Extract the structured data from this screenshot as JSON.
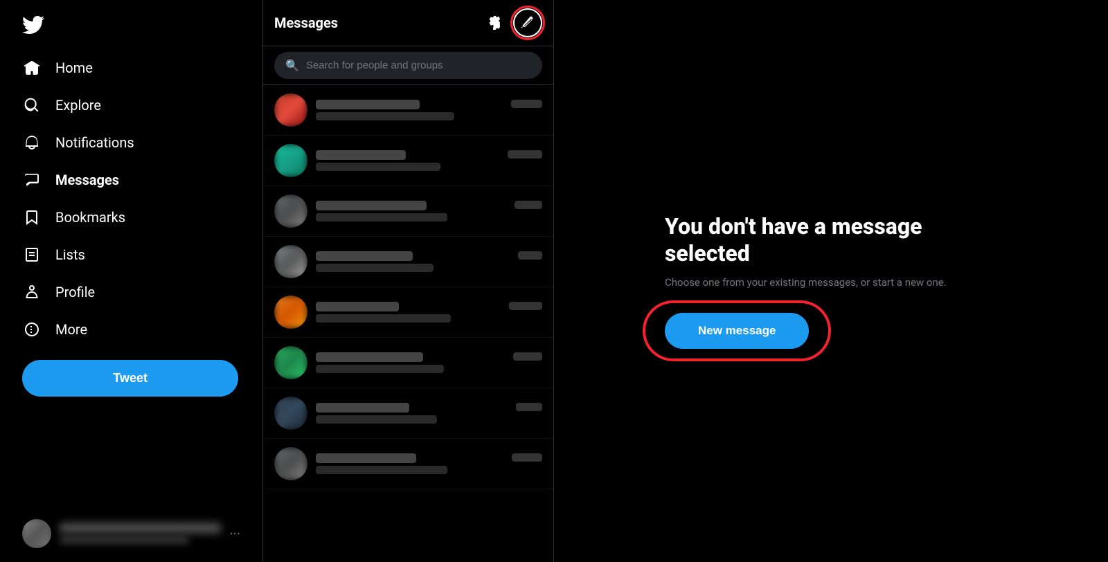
{
  "sidebar": {
    "logo_label": "Twitter",
    "nav_items": [
      {
        "id": "home",
        "label": "Home",
        "icon": "home"
      },
      {
        "id": "explore",
        "label": "Explore",
        "icon": "explore"
      },
      {
        "id": "notifications",
        "label": "Notifications",
        "icon": "bell"
      },
      {
        "id": "messages",
        "label": "Messages",
        "icon": "envelope",
        "active": true
      },
      {
        "id": "bookmarks",
        "label": "Bookmarks",
        "icon": "bookmark"
      },
      {
        "id": "lists",
        "label": "Lists",
        "icon": "list"
      },
      {
        "id": "profile",
        "label": "Profile",
        "icon": "person"
      },
      {
        "id": "more",
        "label": "More",
        "icon": "more-circle"
      }
    ],
    "tweet_button_label": "Tweet",
    "more_dots": "···"
  },
  "messages_panel": {
    "title": "Messages",
    "search_placeholder": "Search for people and groups",
    "settings_icon": "gear",
    "new_message_icon": "compose"
  },
  "main_content": {
    "no_selection_title": "You don't have a message selected",
    "no_selection_subtitle": "Choose one from your existing messages, or start a new one.",
    "new_message_button": "New message"
  }
}
